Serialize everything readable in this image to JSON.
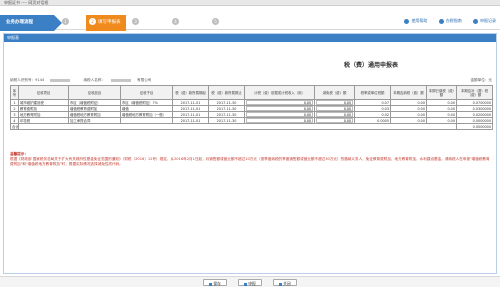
{
  "window": {
    "title": "申报证书 ---- 网页对话框"
  },
  "steps": {
    "main_label": "业务办理流程",
    "items": [
      {
        "num": "1",
        "label": ""
      },
      {
        "num": "2",
        "label": "填写申报表"
      },
      {
        "num": "3",
        "label": "确认申报"
      },
      {
        "num": "4",
        "label": "申报结果"
      },
      {
        "num": "5",
        "label": ""
      }
    ]
  },
  "top_links": [
    {
      "label": "使用帮助"
    },
    {
      "label": "办税指南"
    },
    {
      "label": "申报记录"
    }
  ],
  "panel": {
    "header": "申报表"
  },
  "form": {
    "title": "税（费）通用申报表",
    "taxpayer_id_label": "纳税人识别号：9144",
    "taxpayer_name_label": "纳税人名称：",
    "taxpayer_name_suffix": "有限公司",
    "unit_label": "金额单位：元"
  },
  "table": {
    "headers": [
      "序号",
      "征收项目",
      "征收品目",
      "征收子目",
      "税（费）款所属期起",
      "税（费）款所属期止",
      "计税（费）依据或计税收入（用）",
      "减免税（费）额",
      "税率或单位税额",
      "本期应纳税（费）额",
      "本期已缴税（费）额",
      "本期应补（退）税（费）额"
    ],
    "rows": [
      {
        "no": "1",
        "item": "城市维护建设税",
        "subitem": "市区（增值税附征）",
        "sub": "市区（增值税附征）7%",
        "from": "2017-11-01",
        "to": "2017-11-30",
        "base": "0.00",
        "relief": "0.00",
        "rate": "0.07",
        "due": "0.00",
        "paid": "0.00",
        "balance": "0.0700000"
      },
      {
        "no": "2",
        "item": "教育费附加",
        "subitem": "增值税教育费附加",
        "sub": "增值",
        "from": "2017-11-01",
        "to": "2017-11-30",
        "base": "0.00",
        "relief": "0.00",
        "rate": "0.03",
        "due": "0.00",
        "paid": "0.00",
        "balance": "0.0300000"
      },
      {
        "no": "3",
        "item": "地方教育附加",
        "subitem": "增值税地方教育附加",
        "sub": "增值税地方教育附加（一般）",
        "from": "2017-11-01",
        "to": "2017-11-30",
        "base": "0.00",
        "relief": "0.00",
        "rate": "0.02",
        "due": "0.00",
        "paid": "0.00",
        "balance": "0.0200000"
      },
      {
        "no": "4",
        "item": "印花税",
        "subitem": "加工承揽合同",
        "sub": "",
        "from": "2017-11-01",
        "to": "2017-11-30",
        "base": "0.00",
        "relief": "0.00",
        "rate": "0.0005",
        "due": "0.00",
        "paid": "0.00",
        "balance": "0.0000000"
      }
    ],
    "total": {
      "label": "合计",
      "value": "0.0000000"
    }
  },
  "notes": {
    "heading": "温馨提示：",
    "text": "根据《财政部 国家税务总局关于扩大有关政府性基金免征范围的通知》（财税〔2016〕12号）规定，从2016年2月1日起，月销售额或营业额不超过10万元（按季度纳税的季度销售额或营业额不超过30万元）的缴纳义务人，免征教育费附加、地方教育附加、水利建设基金。请纳税人在申报\"增值税教育费附加\"和\"增值税地方教育附加\"时，根据实际情况选择减免性质代码。"
  },
  "buttons": [
    {
      "label": "保存"
    },
    {
      "label": "申报"
    },
    {
      "label": "关闭"
    }
  ]
}
